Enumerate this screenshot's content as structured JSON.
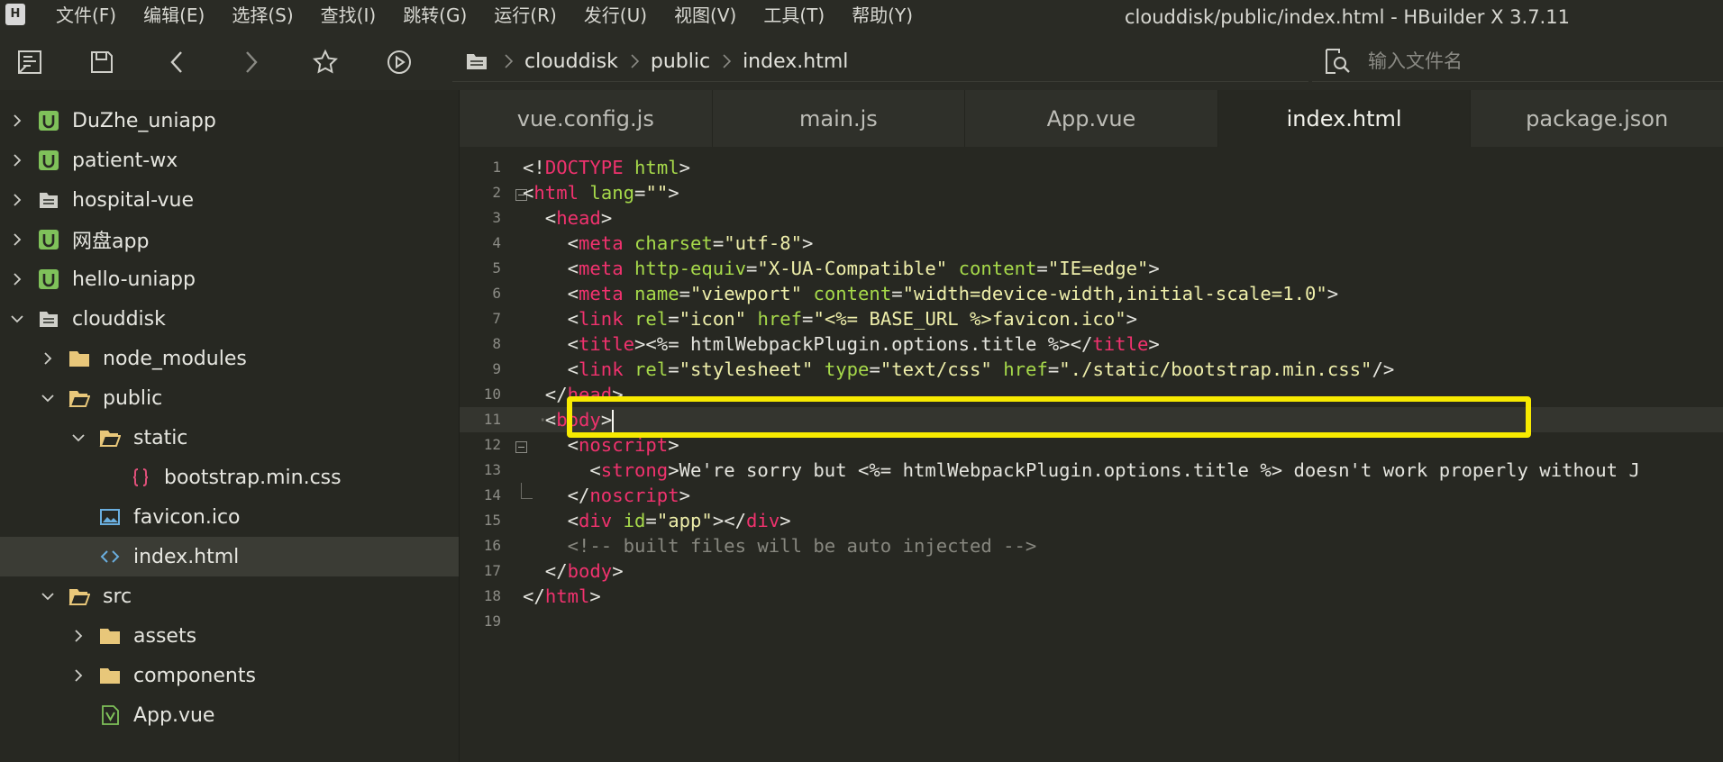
{
  "menubar": {
    "logo": "H",
    "items": [
      "文件(F)",
      "编辑(E)",
      "选择(S)",
      "查找(I)",
      "跳转(G)",
      "运行(R)",
      "发行(U)",
      "视图(V)",
      "工具(T)",
      "帮助(Y)"
    ],
    "window_title": "clouddisk/public/index.html - HBuilder X 3.7.11"
  },
  "toolbar": {
    "buttons": [
      "new-file",
      "save",
      "back",
      "forward",
      "favorite",
      "run"
    ],
    "breadcrumb": [
      "clouddisk",
      "public",
      "index.html"
    ],
    "search_placeholder": "输入文件名"
  },
  "sidebar": {
    "items": [
      {
        "label": "DuZhe_uniapp",
        "icon": "uniapp-project-icon",
        "expanded": false,
        "depth": 0
      },
      {
        "label": "patient-wx",
        "icon": "uniapp-project-icon",
        "expanded": false,
        "depth": 0
      },
      {
        "label": "hospital-vue",
        "icon": "web-project-icon",
        "expanded": false,
        "depth": 0
      },
      {
        "label": "网盘app",
        "icon": "uniapp-project-icon",
        "expanded": false,
        "depth": 0
      },
      {
        "label": "hello-uniapp",
        "icon": "uniapp-project-icon",
        "expanded": false,
        "depth": 0
      },
      {
        "label": "clouddisk",
        "icon": "web-project-icon",
        "expanded": true,
        "depth": 0
      },
      {
        "label": "node_modules",
        "icon": "folder-icon",
        "expanded": false,
        "depth": 1
      },
      {
        "label": "public",
        "icon": "folder-open-icon",
        "expanded": true,
        "depth": 1
      },
      {
        "label": "static",
        "icon": "folder-open-icon",
        "expanded": true,
        "depth": 2
      },
      {
        "label": "bootstrap.min.css",
        "icon": "css-file-icon",
        "expanded": null,
        "depth": 3
      },
      {
        "label": "favicon.ico",
        "icon": "image-file-icon",
        "expanded": null,
        "depth": 2
      },
      {
        "label": "index.html",
        "icon": "html-file-icon",
        "expanded": null,
        "depth": 2,
        "selected": true
      },
      {
        "label": "src",
        "icon": "folder-open-icon",
        "expanded": true,
        "depth": 1
      },
      {
        "label": "assets",
        "icon": "folder-icon",
        "expanded": false,
        "depth": 2
      },
      {
        "label": "components",
        "icon": "folder-icon",
        "expanded": false,
        "depth": 2
      },
      {
        "label": "App.vue",
        "icon": "vue-file-icon",
        "expanded": null,
        "depth": 2
      }
    ]
  },
  "editor": {
    "tabs": [
      {
        "label": "vue.config.js",
        "active": false
      },
      {
        "label": "main.js",
        "active": false
      },
      {
        "label": "App.vue",
        "active": false
      },
      {
        "label": "index.html",
        "active": true
      },
      {
        "label": "package.json",
        "active": false
      }
    ],
    "current_line": 11,
    "highlighted_line": 9,
    "lines": [
      {
        "n": "1",
        "indent": 0,
        "tokens": [
          [
            "p",
            "<!"
          ],
          [
            "tag",
            "DOCTYPE"
          ],
          [
            "tx",
            " "
          ],
          [
            "at",
            "html"
          ],
          [
            "p",
            ">"
          ]
        ]
      },
      {
        "n": "2",
        "indent": 0,
        "fold": "start",
        "tokens": [
          [
            "p",
            "<"
          ],
          [
            "tag",
            "html"
          ],
          [
            "tx",
            " "
          ],
          [
            "at",
            "lang"
          ],
          [
            "p",
            "="
          ],
          [
            "st",
            "\"\""
          ],
          [
            "p",
            ">"
          ]
        ]
      },
      {
        "n": "3",
        "indent": 1,
        "tokens": [
          [
            "p",
            "<"
          ],
          [
            "tag",
            "head"
          ],
          [
            "p",
            ">"
          ]
        ]
      },
      {
        "n": "4",
        "indent": 2,
        "tokens": [
          [
            "p",
            "<"
          ],
          [
            "tag",
            "meta"
          ],
          [
            "tx",
            " "
          ],
          [
            "at",
            "charset"
          ],
          [
            "p",
            "="
          ],
          [
            "st",
            "\"utf-8\""
          ],
          [
            "p",
            ">"
          ]
        ]
      },
      {
        "n": "5",
        "indent": 2,
        "tokens": [
          [
            "p",
            "<"
          ],
          [
            "tag",
            "meta"
          ],
          [
            "tx",
            " "
          ],
          [
            "at",
            "http-equiv"
          ],
          [
            "p",
            "="
          ],
          [
            "st",
            "\"X-UA-Compatible\""
          ],
          [
            "tx",
            " "
          ],
          [
            "at",
            "content"
          ],
          [
            "p",
            "="
          ],
          [
            "st",
            "\"IE=edge\""
          ],
          [
            "p",
            ">"
          ]
        ]
      },
      {
        "n": "6",
        "indent": 2,
        "tokens": [
          [
            "p",
            "<"
          ],
          [
            "tag",
            "meta"
          ],
          [
            "tx",
            " "
          ],
          [
            "at",
            "name"
          ],
          [
            "p",
            "="
          ],
          [
            "st",
            "\"viewport\""
          ],
          [
            "tx",
            " "
          ],
          [
            "at",
            "content"
          ],
          [
            "p",
            "="
          ],
          [
            "st",
            "\"width=device-width,initial-scale=1.0\""
          ],
          [
            "p",
            ">"
          ]
        ]
      },
      {
        "n": "7",
        "indent": 2,
        "tokens": [
          [
            "p",
            "<"
          ],
          [
            "tag",
            "link"
          ],
          [
            "tx",
            " "
          ],
          [
            "at",
            "rel"
          ],
          [
            "p",
            "="
          ],
          [
            "st",
            "\"icon\""
          ],
          [
            "tx",
            " "
          ],
          [
            "at",
            "href"
          ],
          [
            "p",
            "="
          ],
          [
            "st",
            "\"<%= BASE_URL %>favicon.ico\""
          ],
          [
            "p",
            ">"
          ]
        ]
      },
      {
        "n": "8",
        "indent": 2,
        "tokens": [
          [
            "p",
            "<"
          ],
          [
            "tag",
            "title"
          ],
          [
            "p",
            ">"
          ],
          [
            "tx",
            "<%= htmlWebpackPlugin.options.title %>"
          ],
          [
            "p",
            "</"
          ],
          [
            "tag",
            "title"
          ],
          [
            "p",
            ">"
          ]
        ]
      },
      {
        "n": "9",
        "indent": 2,
        "tokens": [
          [
            "p",
            "<"
          ],
          [
            "tag",
            "link"
          ],
          [
            "tx",
            " "
          ],
          [
            "at",
            "rel"
          ],
          [
            "p",
            "="
          ],
          [
            "st",
            "\"stylesheet\""
          ],
          [
            "tx",
            " "
          ],
          [
            "at",
            "type"
          ],
          [
            "p",
            "="
          ],
          [
            "st",
            "\"text/css\""
          ],
          [
            "tx",
            " "
          ],
          [
            "at",
            "href"
          ],
          [
            "p",
            "="
          ],
          [
            "st",
            "\"./static/bootstrap.min.css\""
          ],
          [
            "p",
            "/>"
          ]
        ]
      },
      {
        "n": "10",
        "indent": 1,
        "tokens": [
          [
            "p",
            "</"
          ],
          [
            "tag",
            "head"
          ],
          [
            "p",
            ">"
          ]
        ]
      },
      {
        "n": "11",
        "indent": 1,
        "guide": "··",
        "tokens": [
          [
            "p",
            "<"
          ],
          [
            "tag",
            "body"
          ],
          [
            "p",
            ">"
          ]
        ]
      },
      {
        "n": "12",
        "indent": 2,
        "fold": "start",
        "tokens": [
          [
            "p",
            "<"
          ],
          [
            "tag",
            "noscript"
          ],
          [
            "p",
            ">"
          ]
        ]
      },
      {
        "n": "13",
        "indent": 3,
        "tokens": [
          [
            "p",
            "<"
          ],
          [
            "tag",
            "strong"
          ],
          [
            "p",
            ">"
          ],
          [
            "tx",
            "We're sorry but <%= htmlWebpackPlugin.options.title %> doesn't work properly without J"
          ]
        ]
      },
      {
        "n": "14",
        "indent": 2,
        "fold": "end",
        "tokens": [
          [
            "p",
            "</"
          ],
          [
            "tag",
            "noscript"
          ],
          [
            "p",
            ">"
          ]
        ]
      },
      {
        "n": "15",
        "indent": 2,
        "tokens": [
          [
            "p",
            "<"
          ],
          [
            "tag",
            "div"
          ],
          [
            "tx",
            " "
          ],
          [
            "at",
            "id"
          ],
          [
            "p",
            "="
          ],
          [
            "st",
            "\"app\""
          ],
          [
            "p",
            "></"
          ],
          [
            "tag",
            "div"
          ],
          [
            "p",
            ">"
          ]
        ]
      },
      {
        "n": "16",
        "indent": 2,
        "tokens": [
          [
            "cm",
            "<!-- built files will be auto injected -->"
          ]
        ]
      },
      {
        "n": "17",
        "indent": 1,
        "tokens": [
          [
            "p",
            "</"
          ],
          [
            "tag",
            "body"
          ],
          [
            "p",
            ">"
          ]
        ]
      },
      {
        "n": "18",
        "indent": 0,
        "tokens": [
          [
            "p",
            "</"
          ],
          [
            "tag",
            "html"
          ],
          [
            "p",
            ">"
          ]
        ]
      },
      {
        "n": "19",
        "indent": 0,
        "tokens": []
      }
    ]
  },
  "colors": {
    "background": "#272822",
    "tag": "#f0326e",
    "attribute": "#a6d94a",
    "string": "#eeeeaa",
    "comment": "#87877f",
    "highlight_box": "#f7ea00",
    "uniapp_icon": "#7fc15a",
    "folder": "#e8c77a",
    "html_icon": "#6aaede",
    "css_icon": "#e0507a"
  }
}
